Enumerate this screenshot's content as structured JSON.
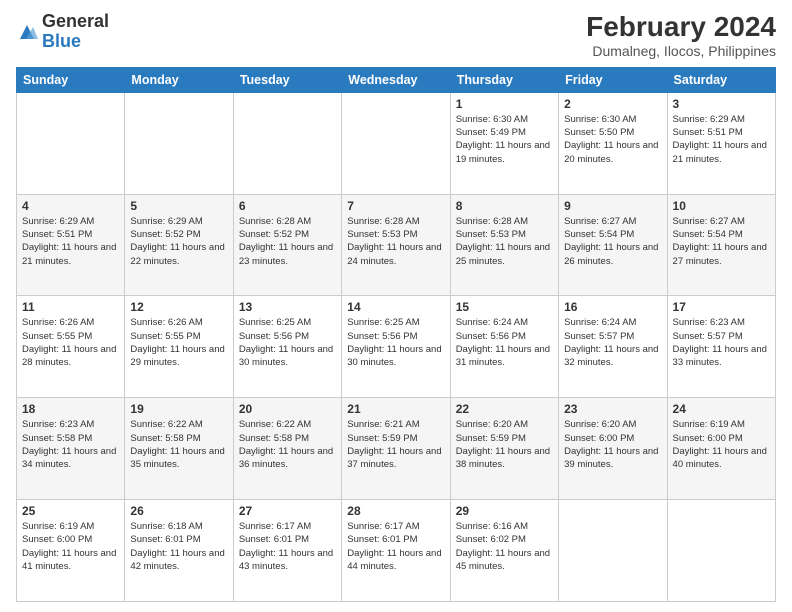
{
  "logo": {
    "text_general": "General",
    "text_blue": "Blue"
  },
  "title": {
    "month_year": "February 2024",
    "location": "Dumalneg, Ilocos, Philippines"
  },
  "weekdays": [
    "Sunday",
    "Monday",
    "Tuesday",
    "Wednesday",
    "Thursday",
    "Friday",
    "Saturday"
  ],
  "weeks": [
    [
      {
        "day": "",
        "info": ""
      },
      {
        "day": "",
        "info": ""
      },
      {
        "day": "",
        "info": ""
      },
      {
        "day": "",
        "info": ""
      },
      {
        "day": "1",
        "info": "Sunrise: 6:30 AM\nSunset: 5:49 PM\nDaylight: 11 hours and 19 minutes."
      },
      {
        "day": "2",
        "info": "Sunrise: 6:30 AM\nSunset: 5:50 PM\nDaylight: 11 hours and 20 minutes."
      },
      {
        "day": "3",
        "info": "Sunrise: 6:29 AM\nSunset: 5:51 PM\nDaylight: 11 hours and 21 minutes."
      }
    ],
    [
      {
        "day": "4",
        "info": "Sunrise: 6:29 AM\nSunset: 5:51 PM\nDaylight: 11 hours and 21 minutes."
      },
      {
        "day": "5",
        "info": "Sunrise: 6:29 AM\nSunset: 5:52 PM\nDaylight: 11 hours and 22 minutes."
      },
      {
        "day": "6",
        "info": "Sunrise: 6:28 AM\nSunset: 5:52 PM\nDaylight: 11 hours and 23 minutes."
      },
      {
        "day": "7",
        "info": "Sunrise: 6:28 AM\nSunset: 5:53 PM\nDaylight: 11 hours and 24 minutes."
      },
      {
        "day": "8",
        "info": "Sunrise: 6:28 AM\nSunset: 5:53 PM\nDaylight: 11 hours and 25 minutes."
      },
      {
        "day": "9",
        "info": "Sunrise: 6:27 AM\nSunset: 5:54 PM\nDaylight: 11 hours and 26 minutes."
      },
      {
        "day": "10",
        "info": "Sunrise: 6:27 AM\nSunset: 5:54 PM\nDaylight: 11 hours and 27 minutes."
      }
    ],
    [
      {
        "day": "11",
        "info": "Sunrise: 6:26 AM\nSunset: 5:55 PM\nDaylight: 11 hours and 28 minutes."
      },
      {
        "day": "12",
        "info": "Sunrise: 6:26 AM\nSunset: 5:55 PM\nDaylight: 11 hours and 29 minutes."
      },
      {
        "day": "13",
        "info": "Sunrise: 6:25 AM\nSunset: 5:56 PM\nDaylight: 11 hours and 30 minutes."
      },
      {
        "day": "14",
        "info": "Sunrise: 6:25 AM\nSunset: 5:56 PM\nDaylight: 11 hours and 30 minutes."
      },
      {
        "day": "15",
        "info": "Sunrise: 6:24 AM\nSunset: 5:56 PM\nDaylight: 11 hours and 31 minutes."
      },
      {
        "day": "16",
        "info": "Sunrise: 6:24 AM\nSunset: 5:57 PM\nDaylight: 11 hours and 32 minutes."
      },
      {
        "day": "17",
        "info": "Sunrise: 6:23 AM\nSunset: 5:57 PM\nDaylight: 11 hours and 33 minutes."
      }
    ],
    [
      {
        "day": "18",
        "info": "Sunrise: 6:23 AM\nSunset: 5:58 PM\nDaylight: 11 hours and 34 minutes."
      },
      {
        "day": "19",
        "info": "Sunrise: 6:22 AM\nSunset: 5:58 PM\nDaylight: 11 hours and 35 minutes."
      },
      {
        "day": "20",
        "info": "Sunrise: 6:22 AM\nSunset: 5:58 PM\nDaylight: 11 hours and 36 minutes."
      },
      {
        "day": "21",
        "info": "Sunrise: 6:21 AM\nSunset: 5:59 PM\nDaylight: 11 hours and 37 minutes."
      },
      {
        "day": "22",
        "info": "Sunrise: 6:20 AM\nSunset: 5:59 PM\nDaylight: 11 hours and 38 minutes."
      },
      {
        "day": "23",
        "info": "Sunrise: 6:20 AM\nSunset: 6:00 PM\nDaylight: 11 hours and 39 minutes."
      },
      {
        "day": "24",
        "info": "Sunrise: 6:19 AM\nSunset: 6:00 PM\nDaylight: 11 hours and 40 minutes."
      }
    ],
    [
      {
        "day": "25",
        "info": "Sunrise: 6:19 AM\nSunset: 6:00 PM\nDaylight: 11 hours and 41 minutes."
      },
      {
        "day": "26",
        "info": "Sunrise: 6:18 AM\nSunset: 6:01 PM\nDaylight: 11 hours and 42 minutes."
      },
      {
        "day": "27",
        "info": "Sunrise: 6:17 AM\nSunset: 6:01 PM\nDaylight: 11 hours and 43 minutes."
      },
      {
        "day": "28",
        "info": "Sunrise: 6:17 AM\nSunset: 6:01 PM\nDaylight: 11 hours and 44 minutes."
      },
      {
        "day": "29",
        "info": "Sunrise: 6:16 AM\nSunset: 6:02 PM\nDaylight: 11 hours and 45 minutes."
      },
      {
        "day": "",
        "info": ""
      },
      {
        "day": "",
        "info": ""
      }
    ]
  ]
}
